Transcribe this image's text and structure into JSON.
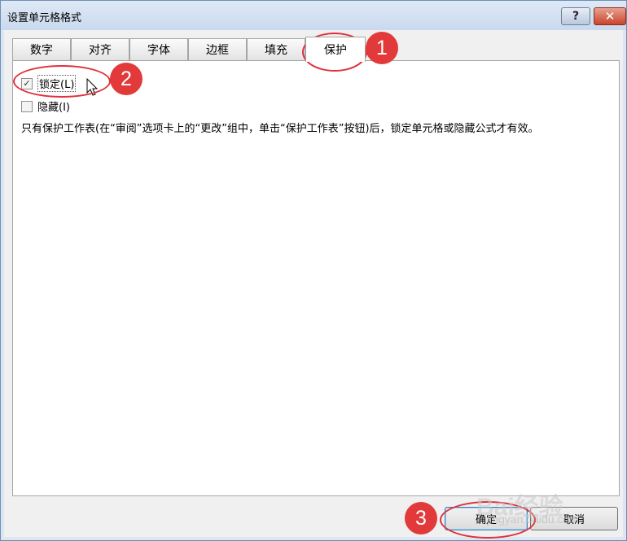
{
  "window": {
    "title": "设置单元格格式",
    "help_label": "?",
    "close_label": "✕"
  },
  "tabs": [
    {
      "label": "数字"
    },
    {
      "label": "对齐"
    },
    {
      "label": "字体"
    },
    {
      "label": "边框"
    },
    {
      "label": "填充"
    },
    {
      "label": "保护",
      "active": true
    }
  ],
  "protection": {
    "locked": {
      "label": "锁定(L)",
      "checked": true
    },
    "hidden": {
      "label": "隐藏(I)",
      "checked": false
    },
    "note": "只有保护工作表(在“审阅”选项卡上的“更改”组中，单击“保护工作表”按钮)后，锁定单元格或隐藏公式才有效。"
  },
  "buttons": {
    "ok": "确定",
    "cancel": "取消"
  },
  "annotations": [
    "1",
    "2",
    "3"
  ],
  "watermark": {
    "main": "Bai经验",
    "sub": "jingyan.baidu.com"
  },
  "colors": {
    "annotation": "#e23a3a",
    "title_bar": "#dbe6f3",
    "close": "#c8442a"
  }
}
